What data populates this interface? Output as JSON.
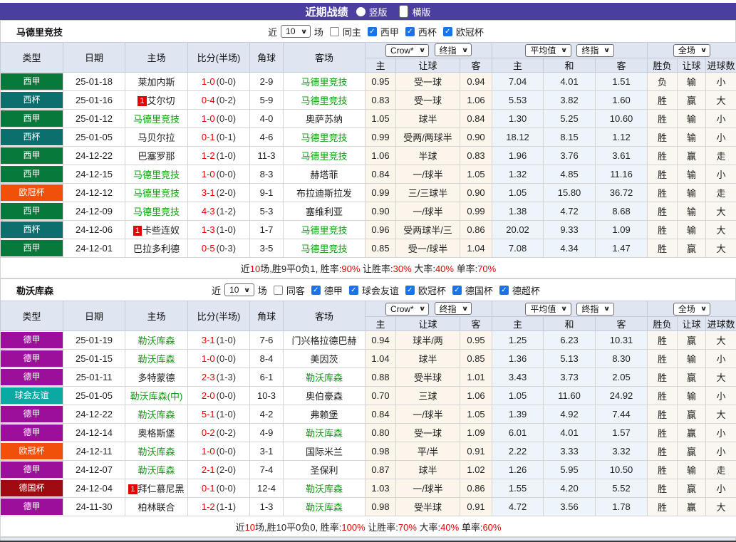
{
  "colors": {
    "topbar": "#4a3f9e",
    "header_bg": "#dfe6f1",
    "liga": "#077a3b",
    "copa": "#0d6e6e",
    "ucl": "#f1500a",
    "bund": "#9b0f9b",
    "friendly": "#0aa9a2",
    "pokal": "#9e0b10",
    "team_green": "#0ca00c",
    "score_red": "#e60000",
    "win_red": "#e60012",
    "lose_blue": "#2323cc",
    "push_green": "#089a08",
    "checkbox_blue": "#1a73e8"
  },
  "topbar": {
    "title": "近期战绩",
    "options": [
      {
        "label": "竖版",
        "selected": false
      },
      {
        "label": "横版",
        "selected": true
      }
    ]
  },
  "table_header": {
    "league": "类型",
    "date": "日期",
    "home": "主场",
    "score": "比分(半场)",
    "corner": "角球",
    "away": "客场",
    "odds_selects": [
      {
        "value": "Crow*"
      },
      {
        "value": "终指"
      }
    ],
    "avg_selects": [
      {
        "value": "平均值"
      },
      {
        "value": "终指"
      }
    ],
    "scope_select": {
      "value": "全场"
    },
    "sub": [
      "主",
      "让球",
      "客",
      "主",
      "和",
      "客",
      "胜负",
      "让球",
      "进球数"
    ]
  },
  "sections": [
    {
      "team": "马德里竞技",
      "filter": {
        "near_label": "近",
        "count": "10",
        "matches_label": "场",
        "same": {
          "label": "同主",
          "checked": false
        },
        "leagues": [
          {
            "label": "西甲",
            "checked": true
          },
          {
            "label": "西杯",
            "checked": true
          },
          {
            "label": "欧冠杯",
            "checked": true
          }
        ]
      },
      "rows": [
        {
          "league": "西甲",
          "lc": "liga",
          "date": "25-01-18",
          "home": "莱加内斯",
          "away": "马德里竞技",
          "away_tracked": true,
          "score": "1-0",
          "half": "(0-0)",
          "corner": "2-9",
          "odds_home": "0.95",
          "handicap": "受一球",
          "odds_away": "0.94",
          "avg_home": "7.04",
          "avg_draw": "4.01",
          "avg_away": "1.51",
          "result_wdl": "负",
          "result_wdl_color": "b",
          "result_handicap": "输",
          "result_handicap_color": "b",
          "result_goals": "小",
          "result_goals_color": "b"
        },
        {
          "league": "西杯",
          "lc": "copa",
          "date": "25-01-16",
          "home": "艾尔切",
          "home_rank": "1",
          "away": "马德里竞技",
          "away_tracked": true,
          "score": "0-4",
          "half": "(0-2)",
          "corner": "5-9",
          "odds_home": "0.83",
          "handicap": "受一球",
          "odds_away": "1.06",
          "avg_home": "5.53",
          "avg_draw": "3.82",
          "avg_away": "1.60",
          "result_wdl": "胜",
          "result_wdl_color": "r",
          "result_handicap": "赢",
          "result_handicap_color": "r",
          "result_goals": "大",
          "result_goals_color": "r"
        },
        {
          "league": "西甲",
          "lc": "liga",
          "date": "25-01-12",
          "home": "马德里竞技",
          "home_tracked": true,
          "away": "奥萨苏纳",
          "score": "1-0",
          "half": "(0-0)",
          "corner": "4-0",
          "odds_home": "1.05",
          "handicap": "球半",
          "odds_away": "0.84",
          "avg_home": "1.30",
          "avg_draw": "5.25",
          "avg_away": "10.60",
          "result_wdl": "胜",
          "result_wdl_color": "r",
          "result_handicap": "输",
          "result_handicap_color": "b",
          "result_goals": "小",
          "result_goals_color": "b"
        },
        {
          "league": "西杯",
          "lc": "copa",
          "date": "25-01-05",
          "home": "马贝尔拉",
          "away": "马德里竞技",
          "away_tracked": true,
          "score": "0-1",
          "half": "(0-1)",
          "corner": "4-6",
          "odds_home": "0.99",
          "handicap": "受两/两球半",
          "odds_away": "0.90",
          "avg_home": "18.12",
          "avg_draw": "8.15",
          "avg_away": "1.12",
          "result_wdl": "胜",
          "result_wdl_color": "r",
          "result_handicap": "输",
          "result_handicap_color": "b",
          "result_goals": "小",
          "result_goals_color": "b"
        },
        {
          "league": "西甲",
          "lc": "liga",
          "date": "24-12-22",
          "home": "巴塞罗那",
          "away": "马德里竞技",
          "away_tracked": true,
          "score": "1-2",
          "half": "(1-0)",
          "corner": "11-3",
          "odds_home": "1.06",
          "handicap": "半球",
          "odds_away": "0.83",
          "avg_home": "1.96",
          "avg_draw": "3.76",
          "avg_away": "3.61",
          "result_wdl": "胜",
          "result_wdl_color": "r",
          "result_handicap": "赢",
          "result_handicap_color": "r",
          "result_goals": "走",
          "result_goals_color": "g"
        },
        {
          "league": "西甲",
          "lc": "liga",
          "date": "24-12-15",
          "home": "马德里竞技",
          "home_tracked": true,
          "away": "赫塔菲",
          "score": "1-0",
          "half": "(0-0)",
          "corner": "8-3",
          "odds_home": "0.84",
          "handicap": "一/球半",
          "odds_away": "1.05",
          "avg_home": "1.32",
          "avg_draw": "4.85",
          "avg_away": "11.16",
          "result_wdl": "胜",
          "result_wdl_color": "r",
          "result_handicap": "输",
          "result_handicap_color": "b",
          "result_goals": "小",
          "result_goals_color": "b"
        },
        {
          "league": "欧冠杯",
          "lc": "ucl",
          "date": "24-12-12",
          "home": "马德里竞技",
          "home_tracked": true,
          "away": "布拉迪斯拉发",
          "score": "3-1",
          "half": "(2-0)",
          "corner": "9-1",
          "odds_home": "0.99",
          "handicap": "三/三球半",
          "odds_away": "0.90",
          "avg_home": "1.05",
          "avg_draw": "15.80",
          "avg_away": "36.72",
          "result_wdl": "胜",
          "result_wdl_color": "r",
          "result_handicap": "输",
          "result_handicap_color": "b",
          "result_goals": "走",
          "result_goals_color": "g"
        },
        {
          "league": "西甲",
          "lc": "liga",
          "date": "24-12-09",
          "home": "马德里竞技",
          "home_tracked": true,
          "away": "塞维利亚",
          "score": "4-3",
          "half": "(1-2)",
          "corner": "5-3",
          "odds_home": "0.90",
          "handicap": "一/球半",
          "odds_away": "0.99",
          "avg_home": "1.38",
          "avg_draw": "4.72",
          "avg_away": "8.68",
          "result_wdl": "胜",
          "result_wdl_color": "r",
          "result_handicap": "输",
          "result_handicap_color": "b",
          "result_goals": "大",
          "result_goals_color": "r"
        },
        {
          "league": "西杯",
          "lc": "copa",
          "date": "24-12-06",
          "home": "卡些连奴",
          "home_rank": "1",
          "away": "马德里竞技",
          "away_tracked": true,
          "score": "1-3",
          "half": "(1-0)",
          "corner": "1-7",
          "odds_home": "0.96",
          "handicap": "受两球半/三",
          "odds_away": "0.86",
          "avg_home": "20.02",
          "avg_draw": "9.33",
          "avg_away": "1.09",
          "result_wdl": "胜",
          "result_wdl_color": "r",
          "result_handicap": "输",
          "result_handicap_color": "b",
          "result_goals": "大",
          "result_goals_color": "r"
        },
        {
          "league": "西甲",
          "lc": "liga",
          "date": "24-12-01",
          "home": "巴拉多利德",
          "away": "马德里竞技",
          "away_tracked": true,
          "score": "0-5",
          "half": "(0-3)",
          "corner": "3-5",
          "odds_home": "0.85",
          "handicap": "受一/球半",
          "odds_away": "1.04",
          "avg_home": "7.08",
          "avg_draw": "4.34",
          "avg_away": "1.47",
          "result_wdl": "胜",
          "result_wdl_color": "r",
          "result_handicap": "赢",
          "result_handicap_color": "r",
          "result_goals": "大",
          "result_goals_color": "r"
        }
      ],
      "summary": [
        {
          "t": "近"
        },
        {
          "t": "10",
          "red": true
        },
        {
          "t": "场,胜9平0负1, 胜率:"
        },
        {
          "t": "90%",
          "red": true
        },
        {
          "t": " 让胜率:"
        },
        {
          "t": "30%",
          "red": true
        },
        {
          "t": " 大率:"
        },
        {
          "t": "40%",
          "red": true
        },
        {
          "t": " 单率:"
        },
        {
          "t": "70%",
          "red": true
        }
      ]
    },
    {
      "team": "勒沃库森",
      "filter": {
        "near_label": "近",
        "count": "10",
        "matches_label": "场",
        "same": {
          "label": "同客",
          "checked": false
        },
        "leagues": [
          {
            "label": "德甲",
            "checked": true
          },
          {
            "label": "球会友谊",
            "checked": true
          },
          {
            "label": "欧冠杯",
            "checked": true
          },
          {
            "label": "德国杯",
            "checked": true
          },
          {
            "label": "德超杯",
            "checked": true
          }
        ]
      },
      "rows": [
        {
          "league": "德甲",
          "lc": "bund",
          "date": "25-01-19",
          "home": "勒沃库森",
          "home_tracked": true,
          "away": "门兴格拉德巴赫",
          "score": "3-1",
          "half": "(1-0)",
          "corner": "7-6",
          "odds_home": "0.94",
          "handicap": "球半/两",
          "odds_away": "0.95",
          "avg_home": "1.25",
          "avg_draw": "6.23",
          "avg_away": "10.31",
          "result_wdl": "胜",
          "result_wdl_color": "r",
          "result_handicap": "赢",
          "result_handicap_color": "r",
          "result_goals": "大",
          "result_goals_color": "r"
        },
        {
          "league": "德甲",
          "lc": "bund",
          "date": "25-01-15",
          "home": "勒沃库森",
          "home_tracked": true,
          "away": "美因茨",
          "score": "1-0",
          "half": "(0-0)",
          "corner": "8-4",
          "odds_home": "1.04",
          "handicap": "球半",
          "odds_away": "0.85",
          "avg_home": "1.36",
          "avg_draw": "5.13",
          "avg_away": "8.30",
          "result_wdl": "胜",
          "result_wdl_color": "r",
          "result_handicap": "输",
          "result_handicap_color": "b",
          "result_goals": "小",
          "result_goals_color": "b"
        },
        {
          "league": "德甲",
          "lc": "bund",
          "date": "25-01-11",
          "home": "多特蒙德",
          "away": "勒沃库森",
          "away_tracked": true,
          "score": "2-3",
          "half": "(1-3)",
          "corner": "6-1",
          "odds_home": "0.88",
          "handicap": "受半球",
          "odds_away": "1.01",
          "avg_home": "3.43",
          "avg_draw": "3.73",
          "avg_away": "2.05",
          "result_wdl": "胜",
          "result_wdl_color": "r",
          "result_handicap": "赢",
          "result_handicap_color": "r",
          "result_goals": "大",
          "result_goals_color": "r"
        },
        {
          "league": "球会友谊",
          "lc": "friendly",
          "date": "25-01-05",
          "home": "勒沃库森(中)",
          "home_tracked": true,
          "away": "奥伯豪森",
          "score": "2-0",
          "half": "(0-0)",
          "corner": "10-3",
          "odds_home": "0.70",
          "handicap": "三球",
          "odds_away": "1.06",
          "avg_home": "1.05",
          "avg_draw": "11.60",
          "avg_away": "24.92",
          "result_wdl": "胜",
          "result_wdl_color": "r",
          "result_handicap": "输",
          "result_handicap_color": "b",
          "result_goals": "小",
          "result_goals_color": "b"
        },
        {
          "league": "德甲",
          "lc": "bund",
          "date": "24-12-22",
          "home": "勒沃库森",
          "home_tracked": true,
          "away": "弗赖堡",
          "score": "5-1",
          "half": "(1-0)",
          "corner": "4-2",
          "odds_home": "0.84",
          "handicap": "一/球半",
          "odds_away": "1.05",
          "avg_home": "1.39",
          "avg_draw": "4.92",
          "avg_away": "7.44",
          "result_wdl": "胜",
          "result_wdl_color": "r",
          "result_handicap": "赢",
          "result_handicap_color": "r",
          "result_goals": "大",
          "result_goals_color": "r"
        },
        {
          "league": "德甲",
          "lc": "bund",
          "date": "24-12-14",
          "home": "奥格斯堡",
          "away": "勒沃库森",
          "away_tracked": true,
          "score": "0-2",
          "half": "(0-2)",
          "corner": "4-9",
          "odds_home": "0.80",
          "handicap": "受一球",
          "odds_away": "1.09",
          "avg_home": "6.01",
          "avg_draw": "4.01",
          "avg_away": "1.57",
          "result_wdl": "胜",
          "result_wdl_color": "r",
          "result_handicap": "赢",
          "result_handicap_color": "r",
          "result_goals": "小",
          "result_goals_color": "b"
        },
        {
          "league": "欧冠杯",
          "lc": "ucl",
          "date": "24-12-11",
          "home": "勒沃库森",
          "home_tracked": true,
          "away": "国际米兰",
          "score": "1-0",
          "half": "(0-0)",
          "corner": "3-1",
          "odds_home": "0.98",
          "handicap": "平/半",
          "odds_away": "0.91",
          "avg_home": "2.22",
          "avg_draw": "3.33",
          "avg_away": "3.32",
          "result_wdl": "胜",
          "result_wdl_color": "r",
          "result_handicap": "赢",
          "result_handicap_color": "r",
          "result_goals": "小",
          "result_goals_color": "b"
        },
        {
          "league": "德甲",
          "lc": "bund",
          "date": "24-12-07",
          "home": "勒沃库森",
          "home_tracked": true,
          "away": "圣保利",
          "score": "2-1",
          "half": "(2-0)",
          "corner": "7-4",
          "odds_home": "0.87",
          "handicap": "球半",
          "odds_away": "1.02",
          "avg_home": "1.26",
          "avg_draw": "5.95",
          "avg_away": "10.50",
          "result_wdl": "胜",
          "result_wdl_color": "r",
          "result_handicap": "输",
          "result_handicap_color": "b",
          "result_goals": "走",
          "result_goals_color": "g"
        },
        {
          "league": "德国杯",
          "lc": "pokal",
          "date": "24-12-04",
          "home": "拜仁慕尼黑",
          "home_rank": "1",
          "away": "勒沃库森",
          "away_tracked": true,
          "score": "0-1",
          "half": "(0-0)",
          "corner": "12-4",
          "odds_home": "1.03",
          "handicap": "一/球半",
          "odds_away": "0.86",
          "avg_home": "1.55",
          "avg_draw": "4.20",
          "avg_away": "5.52",
          "result_wdl": "胜",
          "result_wdl_color": "r",
          "result_handicap": "赢",
          "result_handicap_color": "r",
          "result_goals": "小",
          "result_goals_color": "b"
        },
        {
          "league": "德甲",
          "lc": "bund",
          "date": "24-11-30",
          "home": "柏林联合",
          "away": "勒沃库森",
          "away_tracked": true,
          "score": "1-2",
          "half": "(1-1)",
          "corner": "1-3",
          "odds_home": "0.98",
          "handicap": "受半球",
          "odds_away": "0.91",
          "avg_home": "4.72",
          "avg_draw": "3.56",
          "avg_away": "1.78",
          "result_wdl": "胜",
          "result_wdl_color": "r",
          "result_handicap": "赢",
          "result_handicap_color": "r",
          "result_goals": "大",
          "result_goals_color": "r"
        }
      ],
      "summary": [
        {
          "t": "近"
        },
        {
          "t": "10",
          "red": true
        },
        {
          "t": "场,胜10平0负0, 胜率:"
        },
        {
          "t": "100%",
          "red": true
        },
        {
          "t": " 让胜率:"
        },
        {
          "t": "70%",
          "red": true
        },
        {
          "t": " 大率:"
        },
        {
          "t": "40%",
          "red": true
        },
        {
          "t": " 单率:"
        },
        {
          "t": "60%",
          "red": true
        }
      ]
    }
  ]
}
